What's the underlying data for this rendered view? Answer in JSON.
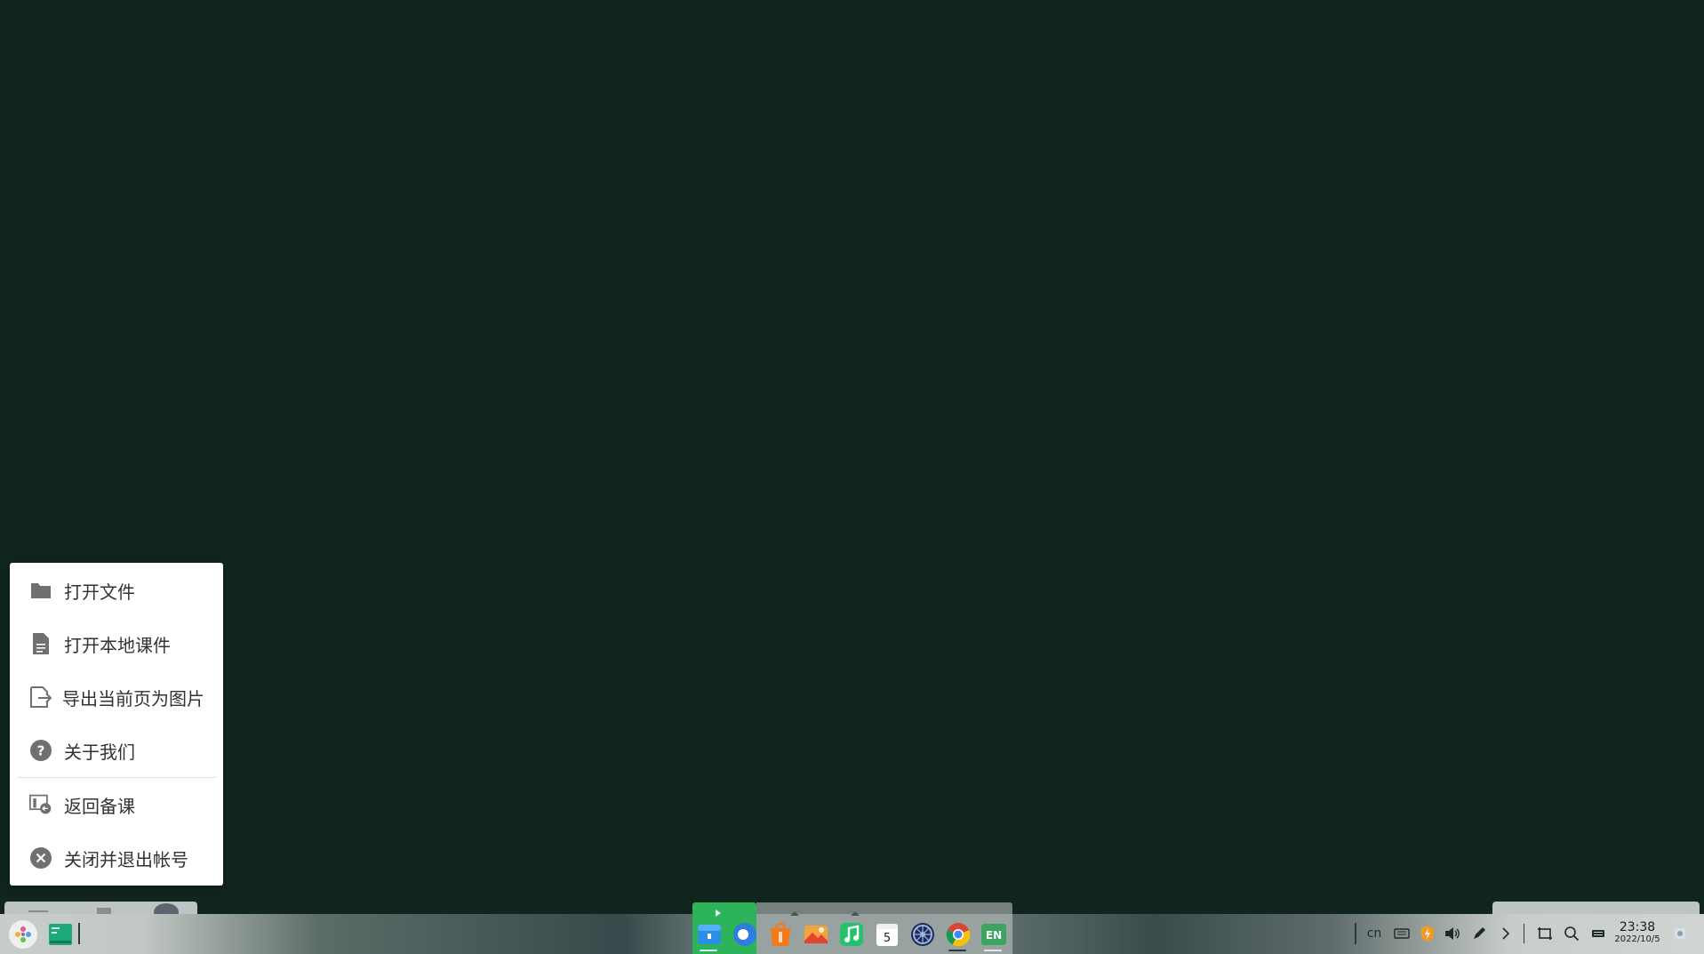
{
  "menu": {
    "items": [
      {
        "label": "打开文件",
        "icon": "folder-icon"
      },
      {
        "label": "打开本地课件",
        "icon": "document-icon"
      },
      {
        "label": "导出当前页为图片",
        "icon": "export-icon"
      },
      {
        "label": "关于我们",
        "icon": "help-icon"
      },
      {
        "label": "返回备课",
        "icon": "return-icon"
      },
      {
        "label": "关闭并退出帐号",
        "icon": "close-circle-icon"
      }
    ]
  },
  "taskbar": {
    "start_icon": "launcher-icon",
    "pinned": [
      "whiteboard-app-icon"
    ],
    "dock_apps": [
      {
        "name": "file-manager-icon",
        "active": true
      },
      {
        "name": "browser-icon",
        "active": false
      },
      {
        "name": "app-store-icon",
        "active": false
      },
      {
        "name": "image-viewer-icon",
        "active": false
      },
      {
        "name": "music-icon",
        "active": false
      },
      {
        "name": "calendar-icon",
        "active": false,
        "text": "5"
      },
      {
        "name": "settings-icon",
        "active": false
      },
      {
        "name": "chrome-icon",
        "active": true
      },
      {
        "name": "en-app-icon",
        "active": true,
        "text": "EN"
      }
    ],
    "tray": {
      "input_method": "cn",
      "clock_time": "23:38",
      "clock_date": "2022/10/5"
    }
  },
  "colors": {
    "desktop": "#11251f",
    "menu_bg": "#ffffff",
    "menu_text": "#333333",
    "icon_gray": "#707070",
    "dock_active": "#2db35a"
  }
}
